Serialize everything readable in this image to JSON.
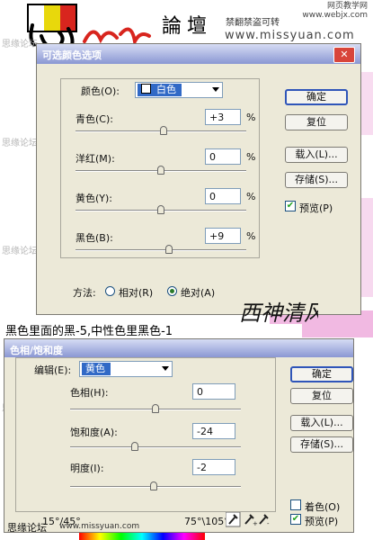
{
  "site": {
    "brand": "論壇",
    "warning": "禁翻禁盗可转",
    "top_right": "网页教学网",
    "top_right_sub": "www.webjx.com",
    "url": "www.missyuan.com",
    "watermark": "思缘论坛",
    "footer_brand": "思缘论坛",
    "footer_url": "www.missyuan.com"
  },
  "colors": {
    "title_grad_top": "#d6dcf4",
    "title_grad_bottom": "#8a97d3",
    "dialog_bg": "#ece9d8",
    "selection": "#3169c6",
    "pink_bg": "#f1b9e2"
  },
  "selective_color": {
    "title": "可选颜色选项",
    "colors_label": "颜色(O):",
    "colors_value": "白色",
    "sliders": [
      {
        "label": "青色(C):",
        "value": "+3",
        "unit": "%",
        "level": 0.515
      },
      {
        "label": "洋红(M):",
        "value": "0",
        "unit": "%",
        "level": 0.5
      },
      {
        "label": "黄色(Y):",
        "value": "0",
        "unit": "%",
        "level": 0.5
      },
      {
        "label": "黑色(B):",
        "value": "+9",
        "unit": "%",
        "level": 0.545
      }
    ],
    "buttons": {
      "ok": "确定",
      "reset": "复位",
      "load": "载入(L)...",
      "save": "存储(S)..."
    },
    "preview_label": "预览(P)",
    "method_label": "方法:",
    "relative_label": "相对(R)",
    "absolute_label": "绝对(A)"
  },
  "caption": "黑色里面的黑-5,中性色里黑色-1",
  "stamp_text": "西神清风",
  "hue_saturation": {
    "title": "色相/饱和度",
    "edit_label": "编辑(E):",
    "edit_value": "黄色",
    "sliders": [
      {
        "label": "色相(H):",
        "value": "0",
        "level": 0.5
      },
      {
        "label": "饱和度(A):",
        "value": "-24",
        "level": 0.38
      },
      {
        "label": "明度(I):",
        "value": "-2",
        "level": 0.49
      }
    ],
    "buttons": {
      "ok": "确定",
      "reset": "复位",
      "load": "载入(L)...",
      "save": "存储(S)..."
    },
    "colorize_label": "着色(O)",
    "preview_label": "预览(P)",
    "range_left": "15°/45°",
    "range_right": "75°\\105°"
  }
}
